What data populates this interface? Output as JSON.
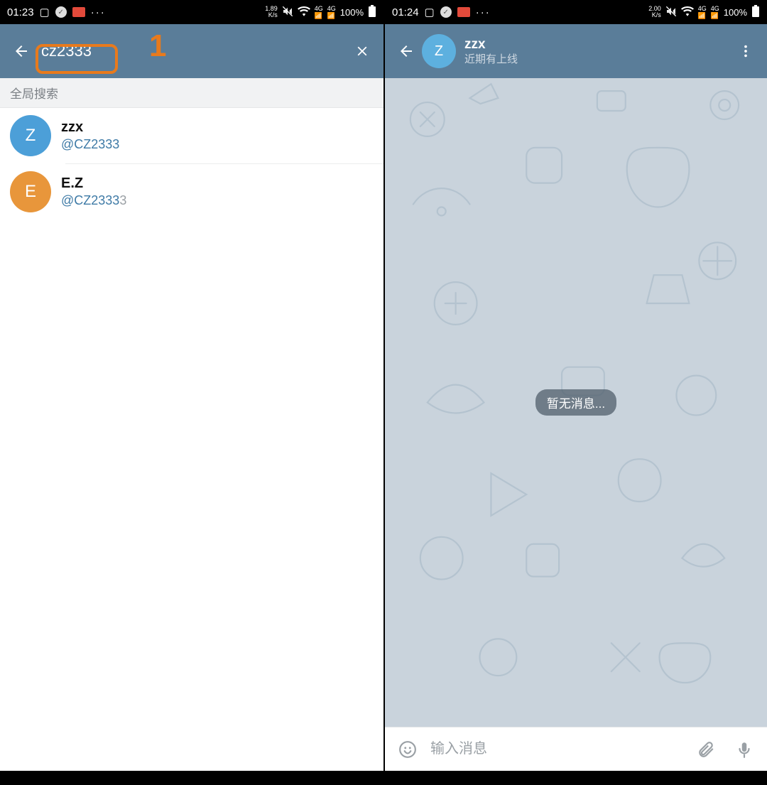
{
  "left": {
    "status": {
      "time": "01:23",
      "net_rate_top": "1.89",
      "net_rate_bot": "K/s",
      "sig": "4G",
      "battery": "100%"
    },
    "search": {
      "value": "cz2333"
    },
    "section_label": "全局搜索",
    "annotation": "1",
    "results": [
      {
        "initial": "Z",
        "color": "blue",
        "name": "zzx",
        "handle": "@CZ2333",
        "dim_suffix": ""
      },
      {
        "initial": "E",
        "color": "orange",
        "name": "E.Z",
        "handle": "@CZ2333",
        "dim_suffix": "3"
      }
    ]
  },
  "right": {
    "status": {
      "time": "01:24",
      "net_rate_top": "2.00",
      "net_rate_bot": "K/s",
      "sig": "4G",
      "battery": "100%"
    },
    "chat": {
      "avatar_initial": "Z",
      "name": "zzx",
      "presence": "近期有上线"
    },
    "empty_label": "暂无消息...",
    "input": {
      "placeholder": "输入消息"
    }
  }
}
